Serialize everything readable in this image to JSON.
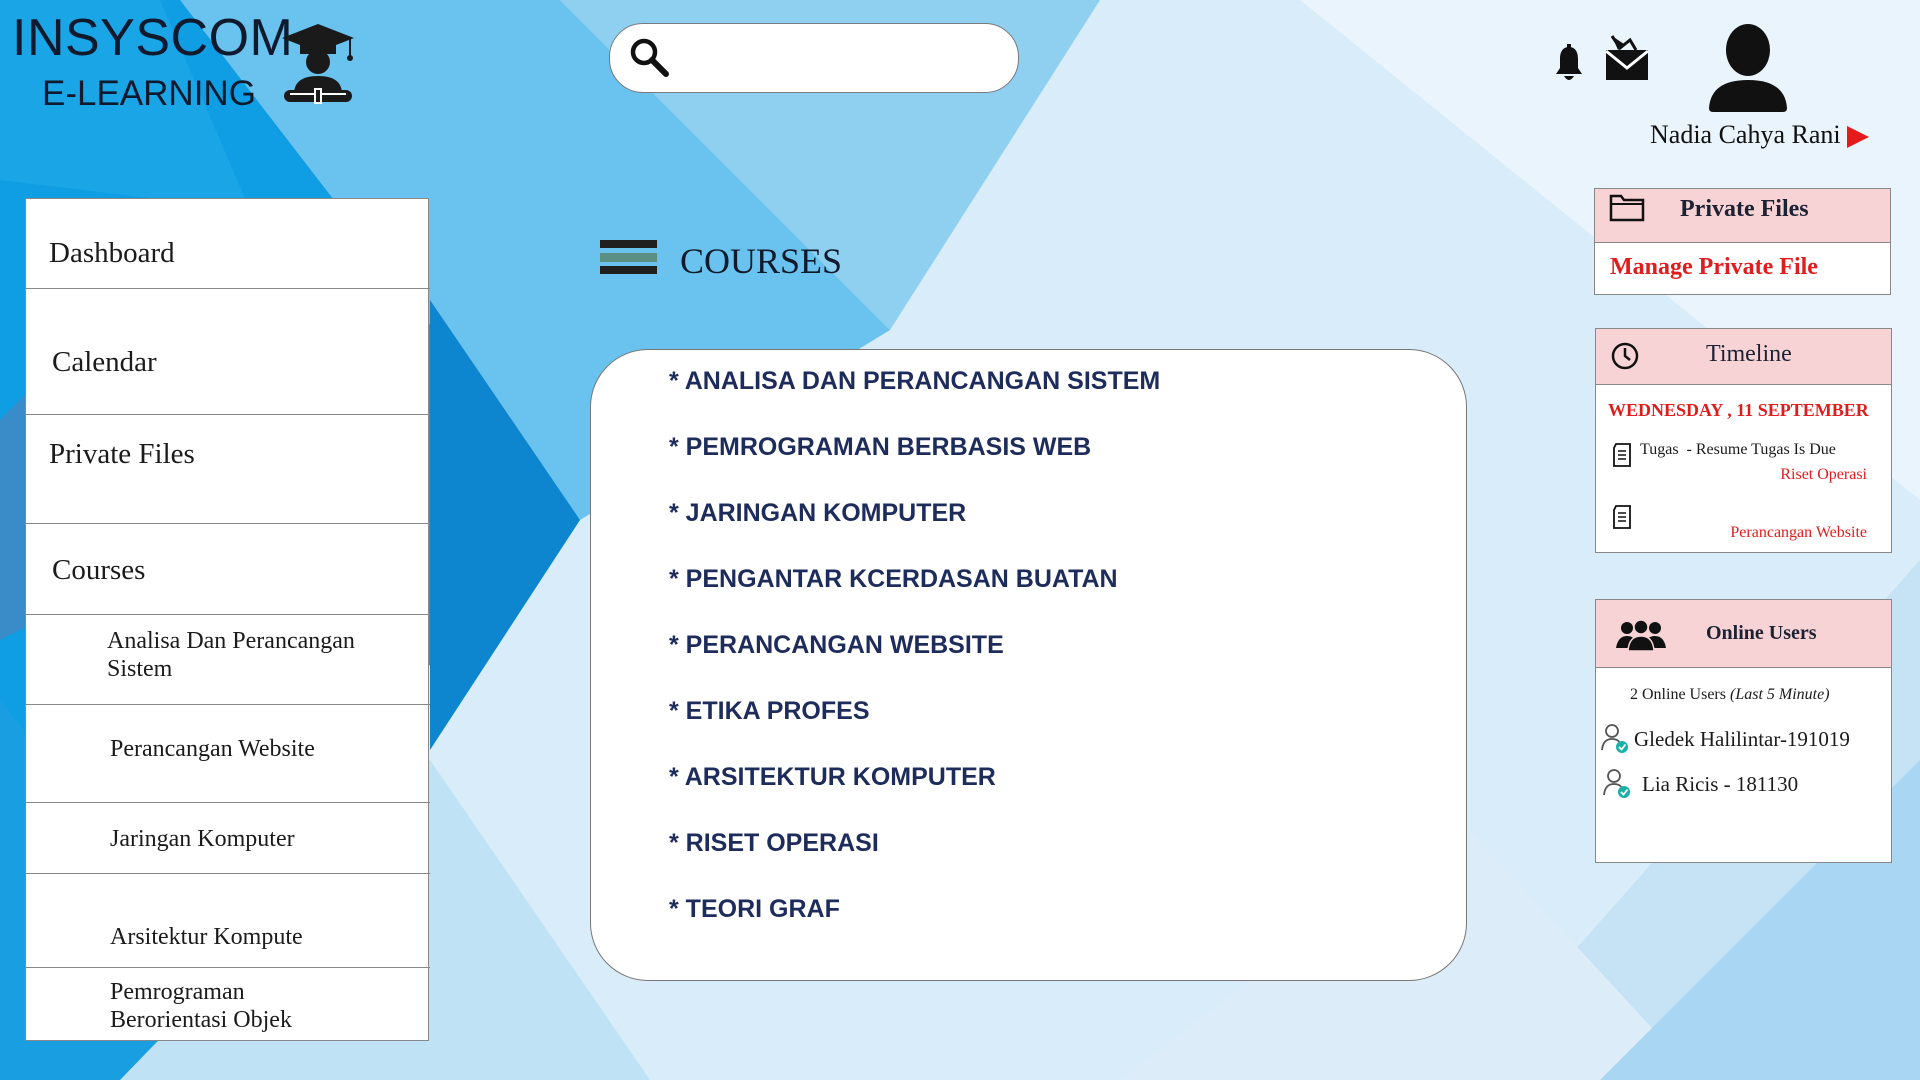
{
  "brand": {
    "title": "INSYSCOM",
    "subtitle": "E-LEARNING"
  },
  "icons": {
    "logo": "graduate-icon",
    "search": "search-icon",
    "notifications": "bell-icon",
    "messages": "mail-icon",
    "user": "user-icon",
    "menu": "arrow-right-icon",
    "folder": "folder-icon",
    "clock": "clock-icon",
    "document": "document-icon",
    "users": "users-icon",
    "online_user": "user-check-icon"
  },
  "search": {
    "placeholder": "",
    "value": ""
  },
  "user": {
    "name": "Nadia Cahya Rani"
  },
  "sidebar": {
    "items": [
      {
        "label": "Dashboard"
      },
      {
        "label": "Calendar"
      },
      {
        "label": "Private Files"
      },
      {
        "label": "Courses"
      }
    ],
    "courses": [
      {
        "label": "Analisa Dan Perancangan Sistem"
      },
      {
        "label": "Perancangan Website"
      },
      {
        "label": "Jaringan Komputer"
      },
      {
        "label": "Arsitektur Kompute"
      },
      {
        "label": "Pemrograman Berorientasi Objek"
      }
    ]
  },
  "main": {
    "title": "COURSES",
    "courses": [
      "* ANALISA DAN PERANCANGAN SISTEM",
      "* PEMROGRAMAN BERBASIS WEB",
      "* JARINGAN KOMPUTER",
      "* PENGANTAR KCERDASAN BUATAN",
      "* PERANCANGAN WEBSITE",
      "* ETIKA PROFES",
      "* ARSITEKTUR KOMPUTER",
      "* RISET OPERASI",
      "* TEORI GRAF"
    ]
  },
  "private_files": {
    "title": "Private Files",
    "link": "Manage Private File"
  },
  "timeline": {
    "title": "Timeline",
    "date": "WEDNESDAY , 11 SEPTEMBER",
    "items": [
      {
        "text": "Tugas  - Resume Tugas Is Due",
        "course": "Riset Operasi"
      },
      {
        "text": "",
        "course": "Perancangan Website"
      }
    ]
  },
  "online_users": {
    "title": "Online Users",
    "summary": "2 Online Users",
    "summary_note": "(Last 5 Minute)",
    "users": [
      {
        "name": "Gledek Halilintar-191019"
      },
      {
        "name": "Lia Ricis - 181130"
      }
    ]
  },
  "colors": {
    "accent": "#e01d1d",
    "panel_head": "#f7d3d6",
    "course_text": "#1e2c5c"
  }
}
